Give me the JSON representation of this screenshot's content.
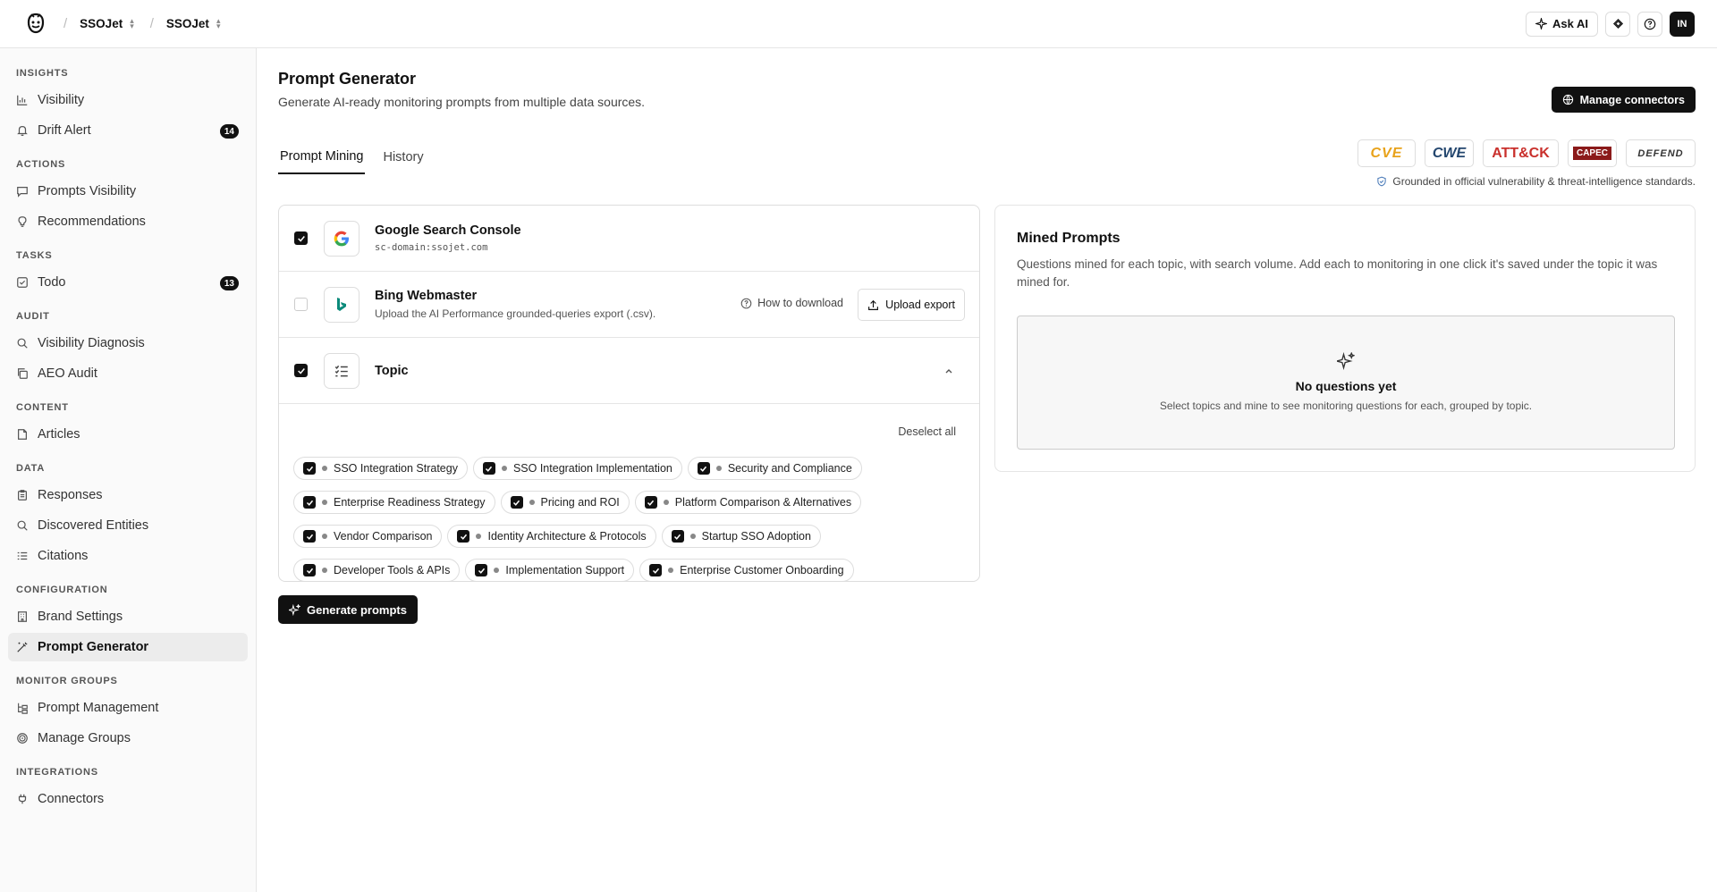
{
  "topbar": {
    "breadcrumb": [
      "SSOJet",
      "SSOJet"
    ],
    "ask_ai_label": "Ask AI",
    "avatar_initials": "IN"
  },
  "sidebar": {
    "sections": [
      {
        "title": "INSIGHTS",
        "items": [
          {
            "label": "Visibility",
            "icon": "bar-chart-icon"
          },
          {
            "label": "Drift Alert",
            "icon": "bell-icon",
            "badge": "14"
          }
        ]
      },
      {
        "title": "ACTIONS",
        "items": [
          {
            "label": "Prompts Visibility",
            "icon": "message-square-icon"
          },
          {
            "label": "Recommendations",
            "icon": "lightbulb-icon"
          }
        ]
      },
      {
        "title": "TASKS",
        "items": [
          {
            "label": "Todo",
            "icon": "check-square-icon",
            "badge": "13"
          }
        ]
      },
      {
        "title": "AUDIT",
        "items": [
          {
            "label": "Visibility Diagnosis",
            "icon": "search-icon"
          },
          {
            "label": "AEO Audit",
            "icon": "copy-icon"
          }
        ]
      },
      {
        "title": "CONTENT",
        "items": [
          {
            "label": "Articles",
            "icon": "file-icon"
          }
        ]
      },
      {
        "title": "DATA",
        "items": [
          {
            "label": "Responses",
            "icon": "clipboard-icon"
          },
          {
            "label": "Discovered Entities",
            "icon": "search-icon"
          },
          {
            "label": "Citations",
            "icon": "list-icon"
          }
        ]
      },
      {
        "title": "CONFIGURATION",
        "items": [
          {
            "label": "Brand Settings",
            "icon": "building-icon"
          },
          {
            "label": "Prompt Generator",
            "icon": "wand-icon",
            "active": true
          }
        ]
      },
      {
        "title": "MONITOR GROUPS",
        "items": [
          {
            "label": "Prompt Management",
            "icon": "folder-tree-icon"
          },
          {
            "label": "Manage Groups",
            "icon": "target-icon"
          }
        ]
      },
      {
        "title": "INTEGRATIONS",
        "items": [
          {
            "label": "Connectors",
            "icon": "plug-icon"
          }
        ]
      }
    ]
  },
  "header": {
    "title": "Prompt Generator",
    "subtitle": "Generate AI-ready monitoring prompts from multiple data sources.",
    "manage_connectors_label": "Manage connectors"
  },
  "tabs": [
    {
      "label": "Prompt Mining",
      "active": true
    },
    {
      "label": "History",
      "active": false
    }
  ],
  "standards": {
    "logos": [
      "CVE",
      "CWE",
      "ATT&CK",
      "CAPEC",
      "DEFEND"
    ],
    "grounded_text": "Grounded in official vulnerability & threat-intelligence standards."
  },
  "sources": {
    "google": {
      "name": "Google Search Console",
      "desc": "sc-domain:ssojet.com",
      "checked": true
    },
    "bing": {
      "name": "Bing Webmaster",
      "desc": "Upload the AI Performance grounded-queries export (.csv).",
      "checked": false,
      "how_to_label": "How to download",
      "upload_label": "Upload export"
    },
    "topic": {
      "name": "Topic",
      "checked": true,
      "deselect_label": "Deselect all"
    }
  },
  "topics": [
    "SSO Integration Strategy",
    "SSO Integration Implementation",
    "Security and Compliance",
    "Enterprise Readiness Strategy",
    "Pricing and ROI",
    "Platform Comparison & Alternatives",
    "Vendor Comparison",
    "Identity Architecture & Protocols",
    "Startup SSO Adoption",
    "Developer Tools & APIs",
    "Implementation Support",
    "Enterprise Customer Onboarding"
  ],
  "generate_label": "Generate prompts",
  "mined": {
    "title": "Mined Prompts",
    "desc": "Questions mined for each topic, with search volume. Add each to monitoring in one click it's saved under the topic it was mined for.",
    "empty_title": "No questions yet",
    "empty_sub": "Select topics and mine to see monitoring questions for each, grouped by topic."
  }
}
